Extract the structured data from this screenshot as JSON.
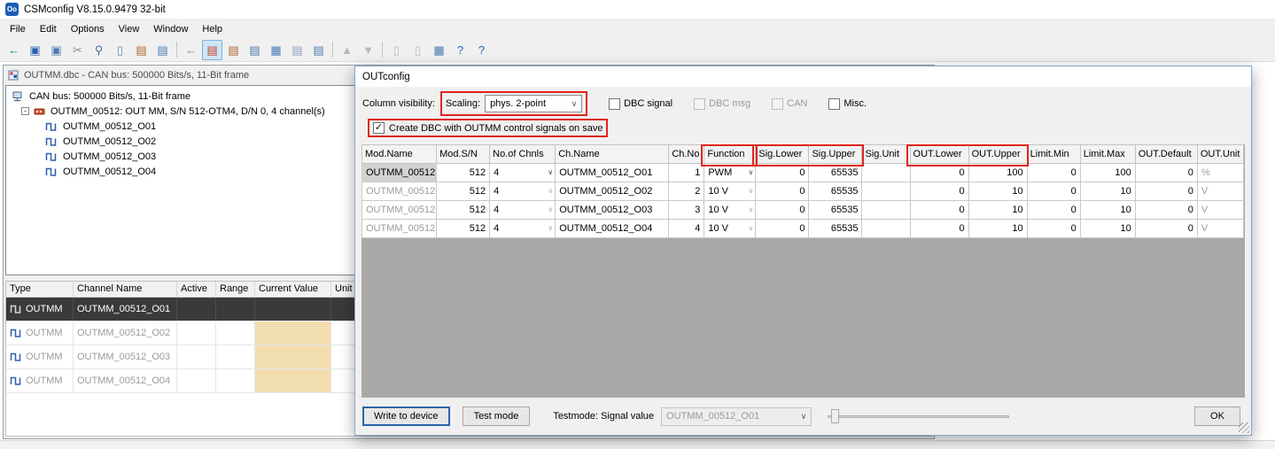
{
  "colors": {
    "highlight_red": "#e0241c",
    "value_cell_tan": "#f3deb0",
    "selected_row_bg": "#3a3a3a"
  },
  "app": {
    "title": "CSMconfig V8.15.0.9479 32-bit",
    "icon_text": "Oo",
    "menu": [
      "File",
      "Edit",
      "Options",
      "View",
      "Window",
      "Help"
    ]
  },
  "toolbar": {
    "icons": [
      {
        "name": "back-icon",
        "glyph": "←",
        "color": "#1d8a67"
      },
      {
        "name": "save-icon",
        "glyph": "▣",
        "color": "#2a5db0"
      },
      {
        "name": "save-all-icon",
        "glyph": "▣",
        "color": "#4a7ab0"
      },
      {
        "name": "disconnect-icon",
        "glyph": "✂",
        "color": "#8a8a8a"
      },
      {
        "name": "search-icon",
        "glyph": "⚲",
        "color": "#4a6ea8"
      },
      {
        "name": "new-document-icon",
        "glyph": "▯",
        "color": "#6a8ab8"
      },
      {
        "name": "device-config-icon",
        "glyph": "▤",
        "color": "#b0622e"
      },
      {
        "name": "device-settings-icon",
        "glyph": "▤",
        "color": "#4a7ab0"
      },
      {
        "sep": true
      },
      {
        "name": "offline-icon",
        "glyph": "←",
        "color": "#8a8a8a"
      },
      {
        "name": "online-config-icon",
        "glyph": "▤",
        "color": "#c2401f",
        "state": "selected"
      },
      {
        "name": "module-config-icon",
        "glyph": "▤",
        "color": "#b0622e"
      },
      {
        "name": "module-config2-icon",
        "glyph": "▤",
        "color": "#4a7ab0"
      },
      {
        "name": "config-table-icon",
        "glyph": "▦",
        "color": "#4a7ab0"
      },
      {
        "name": "device2-icon",
        "glyph": "▤",
        "color": "#8aa0c0"
      },
      {
        "name": "device3-icon",
        "glyph": "▤",
        "color": "#4a7ab0"
      },
      {
        "sep": true
      },
      {
        "name": "sort-asc-icon",
        "glyph": "▲",
        "color": "#b8b8b8",
        "state": "disabled"
      },
      {
        "name": "sort-desc-icon",
        "glyph": "▼",
        "color": "#b8b8b8",
        "state": "disabled"
      },
      {
        "sep": true
      },
      {
        "name": "copy-icon",
        "glyph": "▯",
        "color": "#b8b8b8",
        "state": "disabled"
      },
      {
        "name": "paste-icon",
        "glyph": "▯",
        "color": "#b8b8b8",
        "state": "disabled"
      },
      {
        "name": "grid-icon",
        "glyph": "▦",
        "color": "#4a7ab0"
      },
      {
        "name": "help-icon",
        "glyph": "?",
        "color": "#2a5db0"
      },
      {
        "name": "context-help-icon",
        "glyph": "?",
        "color": "#2a5db0"
      }
    ]
  },
  "doc_window": {
    "title": "OUTMM.dbc - CAN bus: 500000 Bits/s, 11-Bit frame",
    "tree": {
      "root": "CAN bus: 500000 Bits/s, 11-Bit frame",
      "module": "OUTMM_00512: OUT MM, S/N 512-OTM4, D/N 0, 4 channel(s)",
      "channels": [
        "OUTMM_00512_O01",
        "OUTMM_00512_O02",
        "OUTMM_00512_O03",
        "OUTMM_00512_O04"
      ]
    },
    "channel_table": {
      "headers": [
        "Type",
        "Channel Name",
        "Active",
        "Range",
        "Current Value",
        "Unit"
      ],
      "rows": [
        {
          "type": "OUTMM",
          "name": "OUTMM_00512_O01",
          "active": "",
          "range": "",
          "current_value": "",
          "unit": "",
          "selected": true
        },
        {
          "type": "OUTMM",
          "name": "OUTMM_00512_O02",
          "active": "",
          "range": "",
          "current_value": "",
          "unit": "",
          "selected": false
        },
        {
          "type": "OUTMM",
          "name": "OUTMM_00512_O03",
          "active": "",
          "range": "",
          "current_value": "",
          "unit": "",
          "selected": false
        },
        {
          "type": "OUTMM",
          "name": "OUTMM_00512_O04",
          "active": "",
          "range": "",
          "current_value": "",
          "unit": "",
          "selected": false
        }
      ]
    }
  },
  "dialog": {
    "title": "OUTconfig",
    "column_visibility_label": "Column visibility:",
    "scaling_label": "Scaling:",
    "scaling_value": "phys. 2-point",
    "visibility_checkboxes": [
      {
        "label": "DBC signal",
        "checked": false,
        "disabled": false
      },
      {
        "label": "DBC msg",
        "checked": false,
        "disabled": true
      },
      {
        "label": "CAN",
        "checked": false,
        "disabled": true
      },
      {
        "label": "Misc.",
        "checked": false,
        "disabled": false
      }
    ],
    "create_dbc": {
      "label": "Create DBC with OUTMM control signals on save",
      "checked": true
    },
    "table": {
      "headers": [
        "Mod.Name",
        "Mod.S/N",
        "No.of Chnls",
        "Ch.Name",
        "Ch.No",
        "Function",
        "Sig.Lower",
        "Sig.Upper",
        "Sig.Unit",
        "OUT.Lower",
        "OUT.Upper",
        "Limit.Min",
        "Limit.Max",
        "OUT.Default",
        "OUT.Unit"
      ],
      "rows": [
        [
          "OUTMM_00512",
          "512",
          "4",
          "OUTMM_00512_O01",
          "1",
          "PWM",
          "0",
          "65535",
          "",
          "0",
          "100",
          "0",
          "100",
          "0",
          "%"
        ],
        [
          "OUTMM_00512",
          "512",
          "4",
          "OUTMM_00512_O02",
          "2",
          "10 V",
          "0",
          "65535",
          "",
          "0",
          "10",
          "0",
          "10",
          "0",
          "V"
        ],
        [
          "OUTMM_00512",
          "512",
          "4",
          "OUTMM_00512_O03",
          "3",
          "10 V",
          "0",
          "65535",
          "",
          "0",
          "10",
          "0",
          "10",
          "0",
          "V"
        ],
        [
          "OUTMM_00512",
          "512",
          "4",
          "OUTMM_00512_O04",
          "4",
          "10 V",
          "0",
          "65535",
          "",
          "0",
          "10",
          "0",
          "10",
          "0",
          "V"
        ]
      ]
    },
    "footer": {
      "write_button": "Write to device",
      "test_button": "Test mode",
      "testmode_label": "Testmode: Signal value",
      "signal_value": "OUTMM_00512_O01",
      "ok_button": "OK"
    }
  }
}
